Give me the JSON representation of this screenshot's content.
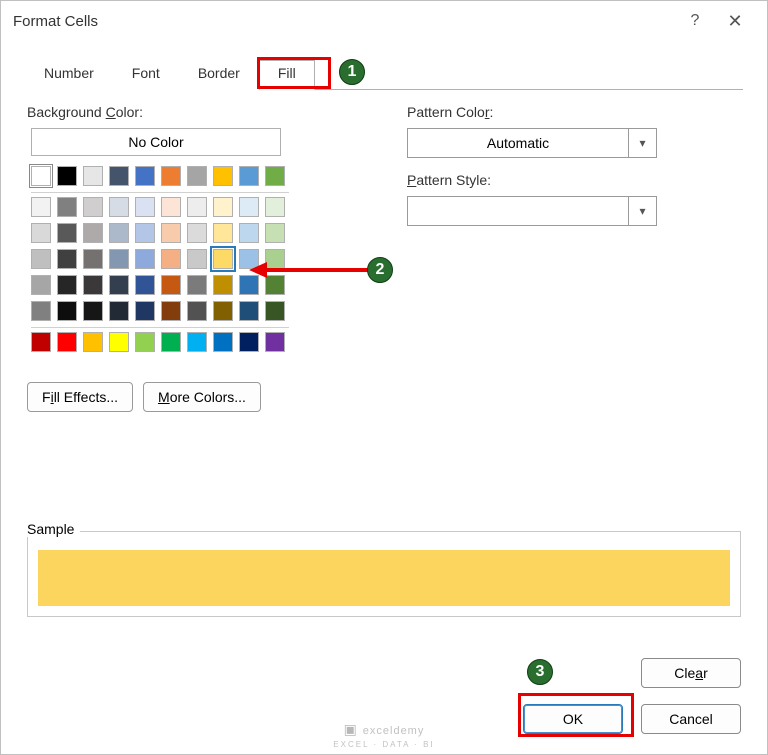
{
  "title": "Format Cells",
  "tabs": [
    "Number",
    "Font",
    "Border",
    "Fill"
  ],
  "active_tab": "Fill",
  "labels": {
    "bg_color": "Background Color:",
    "no_color": "No Color",
    "pattern_color": "Pattern Color:",
    "pattern_style": "Pattern Style:",
    "fill_effects": "Fill Effects...",
    "more_colors": "More Colors...",
    "sample": "Sample",
    "clear": "Clear",
    "ok": "OK",
    "cancel": "Cancel"
  },
  "pattern_color_value": "Automatic",
  "pattern_style_value": "",
  "selected_color": "#fdd966",
  "sample_fill": "#fcd55e",
  "palette": {
    "theme_row": [
      "#ffffff",
      "#000000",
      "#e7e6e6",
      "#44546a",
      "#4472c4",
      "#ed7d31",
      "#a5a5a5",
      "#ffc000",
      "#5b9bd5",
      "#70ad47"
    ],
    "tints": [
      [
        "#f2f2f2",
        "#808080",
        "#d0cece",
        "#d6dce5",
        "#d9e1f2",
        "#fce4d6",
        "#ededed",
        "#fff2cc",
        "#ddebf7",
        "#e2efda"
      ],
      [
        "#d9d9d9",
        "#595959",
        "#aeaaaa",
        "#acb9ca",
        "#b4c6e7",
        "#f8cbad",
        "#dbdbdb",
        "#ffe699",
        "#bdd7ee",
        "#c6e0b4"
      ],
      [
        "#bfbfbf",
        "#404040",
        "#757171",
        "#8497b0",
        "#8ea9db",
        "#f4b084",
        "#c9c9c9",
        "#fdd966",
        "#9bc2e6",
        "#a9d08e"
      ],
      [
        "#a6a6a6",
        "#262626",
        "#3a3838",
        "#333f4f",
        "#305496",
        "#c65911",
        "#7b7b7b",
        "#bf8f00",
        "#2f75b5",
        "#548235"
      ],
      [
        "#808080",
        "#0d0d0d",
        "#161616",
        "#222b35",
        "#203764",
        "#833c0c",
        "#525252",
        "#806000",
        "#1f4e78",
        "#375623"
      ]
    ],
    "standard": [
      "#c00000",
      "#ff0000",
      "#ffc000",
      "#ffff00",
      "#92d050",
      "#00b050",
      "#00b0f0",
      "#0070c0",
      "#002060",
      "#7030a0"
    ]
  },
  "annotations": {
    "num1": "1",
    "num2": "2",
    "num3": "3"
  },
  "watermark": {
    "brand": "exceldemy",
    "sub": "EXCEL · DATA · BI"
  }
}
